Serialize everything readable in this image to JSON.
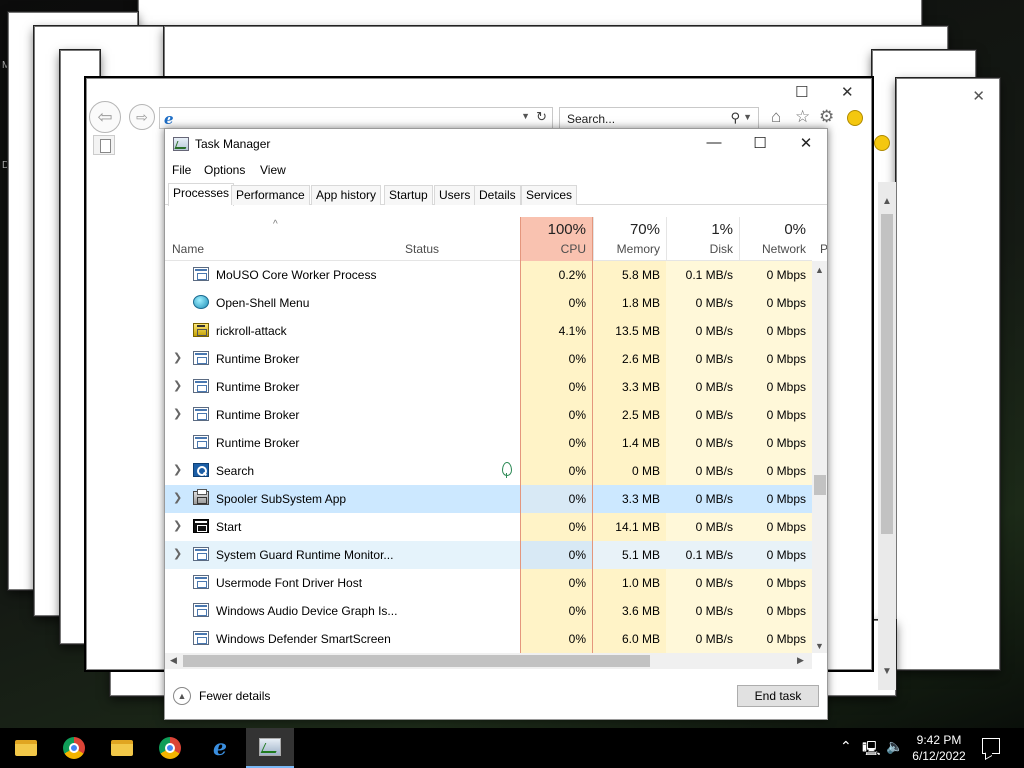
{
  "ie": {
    "search_placeholder": "Search...",
    "close_glyph": "✕",
    "max_glyph": "☐"
  },
  "task_manager": {
    "title": "Task Manager",
    "menu": [
      "File",
      "Options",
      "View"
    ],
    "tabs": [
      "Processes",
      "Performance",
      "App history",
      "Startup",
      "Users",
      "Details",
      "Services"
    ],
    "active_tab": "Processes",
    "columns": {
      "name": "Name",
      "status": "Status",
      "cpu": {
        "pct": "100%",
        "label": "CPU"
      },
      "memory": {
        "pct": "70%",
        "label": "Memory"
      },
      "disk": {
        "pct": "1%",
        "label": "Disk"
      },
      "network": {
        "pct": "0%",
        "label": "Network"
      },
      "extra": "P"
    },
    "processes": [
      {
        "name": "MoUSO Core Worker Process",
        "cpu": "0.2%",
        "memory": "5.8 MB",
        "disk": "0.1 MB/s",
        "network": "0 Mbps"
      },
      {
        "name": "Open-Shell Menu",
        "cpu": "0%",
        "memory": "1.8 MB",
        "disk": "0 MB/s",
        "network": "0 Mbps"
      },
      {
        "name": "rickroll-attack",
        "cpu": "4.1%",
        "memory": "13.5 MB",
        "disk": "0 MB/s",
        "network": "0 Mbps"
      },
      {
        "name": "Runtime Broker",
        "cpu": "0%",
        "memory": "2.6 MB",
        "disk": "0 MB/s",
        "network": "0 Mbps"
      },
      {
        "name": "Runtime Broker",
        "cpu": "0%",
        "memory": "3.3 MB",
        "disk": "0 MB/s",
        "network": "0 Mbps"
      },
      {
        "name": "Runtime Broker",
        "cpu": "0%",
        "memory": "2.5 MB",
        "disk": "0 MB/s",
        "network": "0 Mbps"
      },
      {
        "name": "Runtime Broker",
        "cpu": "0%",
        "memory": "1.4 MB",
        "disk": "0 MB/s",
        "network": "0 Mbps"
      },
      {
        "name": "Search",
        "cpu": "0%",
        "memory": "0 MB",
        "disk": "0 MB/s",
        "network": "0 Mbps"
      },
      {
        "name": "Spooler SubSystem App",
        "cpu": "0%",
        "memory": "3.3 MB",
        "disk": "0 MB/s",
        "network": "0 Mbps"
      },
      {
        "name": "Start",
        "cpu": "0%",
        "memory": "14.1 MB",
        "disk": "0 MB/s",
        "network": "0 Mbps"
      },
      {
        "name": "System Guard Runtime Monitor...",
        "cpu": "0%",
        "memory": "5.1 MB",
        "disk": "0.1 MB/s",
        "network": "0 Mbps"
      },
      {
        "name": "Usermode Font Driver Host",
        "cpu": "0%",
        "memory": "1.0 MB",
        "disk": "0 MB/s",
        "network": "0 Mbps"
      },
      {
        "name": "Windows Audio Device Graph Is...",
        "cpu": "0%",
        "memory": "3.6 MB",
        "disk": "0 MB/s",
        "network": "0 Mbps"
      },
      {
        "name": "Windows Defender SmartScreen",
        "cpu": "0%",
        "memory": "6.0 MB",
        "disk": "0 MB/s",
        "network": "0 Mbps"
      }
    ],
    "fewer_details": "Fewer details",
    "end_task": "End task"
  },
  "taskbar": {
    "time": "9:42 PM",
    "date": "6/12/2022"
  },
  "icons": [
    "back-arrow-icon",
    "forward-arrow-icon",
    "ie-logo-icon",
    "refresh-icon",
    "search-icon",
    "home-icon",
    "star-icon",
    "gear-icon",
    "smiley-icon",
    "task-manager-icon",
    "file-explorer-icon",
    "chrome-icon",
    "leaf-icon",
    "chevron-up-icon",
    "network-icon",
    "volume-icon",
    "notification-icon"
  ]
}
